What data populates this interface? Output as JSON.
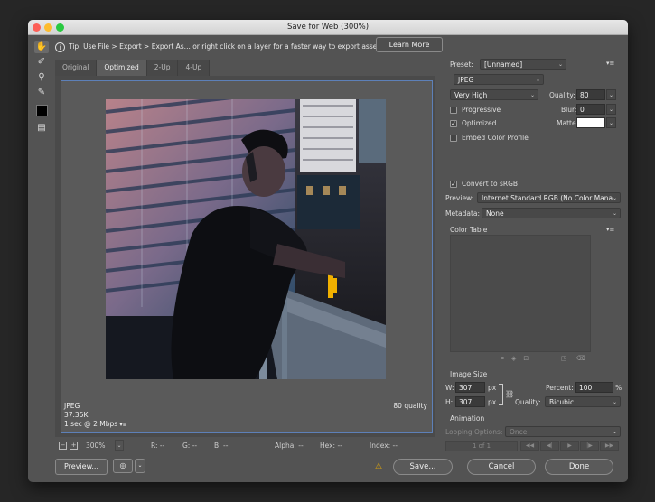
{
  "window": {
    "title": "Save for Web (300%)"
  },
  "tip": {
    "text": "Tip: Use File > Export > Export As...  or right click on a layer for a faster way to export assets",
    "learn_more": "Learn More"
  },
  "tools": [
    "hand-tool-icon",
    "slice-select-tool-icon",
    "zoom-tool-icon",
    "eyedropper-tool-icon",
    "eyedropper-color-swatch",
    "toggle-slices-icon"
  ],
  "tabs": [
    "Original",
    "Optimized",
    "2-Up",
    "4-Up"
  ],
  "active_tab": "Optimized",
  "canvas_info": {
    "format": "JPEG",
    "size": "37.35K",
    "speed": "1 sec @ 2 Mbps",
    "quality": "80 quality"
  },
  "status": {
    "zoom": "300%",
    "r": "R: --",
    "g": "G: --",
    "b": "B: --",
    "alpha": "Alpha: --",
    "hex": "Hex: --",
    "index": "Index: --"
  },
  "settings": {
    "preset_label": "Preset:",
    "preset_value": "[Unnamed]",
    "format": "JPEG",
    "quality_level": "Very High",
    "quality_label": "Quality:",
    "quality_value": "80",
    "progressive_label": "Progressive",
    "progressive": false,
    "blur_label": "Blur:",
    "blur_value": "0",
    "optimized_label": "Optimized",
    "optimized": true,
    "matte_label": "Matte:",
    "matte_color": "#ffffff",
    "embed_profile_label": "Embed Color Profile",
    "embed_profile": false,
    "convert_srgb_label": "Convert to sRGB",
    "convert_srgb": true,
    "preview_label": "Preview:",
    "preview_value": "Internet Standard RGB (No Color Mana...",
    "metadata_label": "Metadata:",
    "metadata_value": "None",
    "color_table_label": "Color Table"
  },
  "image_size": {
    "label": "Image Size",
    "w_label": "W:",
    "w_value": "307",
    "w_unit": "px",
    "h_label": "H:",
    "h_value": "307",
    "h_unit": "px",
    "percent_label": "Percent:",
    "percent_value": "100",
    "percent_unit": "%",
    "quality_label": "Quality:",
    "quality_value": "Bicubic"
  },
  "animation": {
    "label": "Animation",
    "looping_label": "Looping Options:",
    "looping_value": "Once",
    "frame": "1 of 1"
  },
  "buttons": {
    "preview": "Preview...",
    "save": "Save...",
    "cancel": "Cancel",
    "done": "Done"
  },
  "colors": {
    "canvas_border": "#5d80b8",
    "window_bg": "#535353"
  }
}
